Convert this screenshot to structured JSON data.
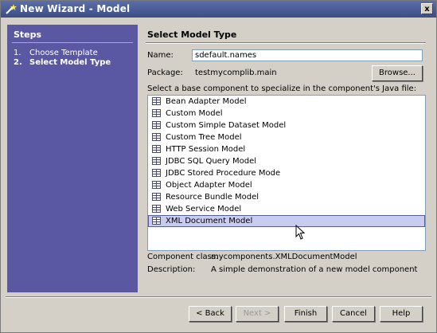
{
  "window": {
    "title": "New Wizard - Model",
    "close_label": "x"
  },
  "steps": {
    "header": "Steps",
    "items": [
      {
        "number": "1.",
        "label": "Choose Template"
      },
      {
        "number": "2.",
        "label": "Select Model Type"
      }
    ]
  },
  "page": {
    "title": "Select Model Type",
    "name_label": "Name:",
    "name_value": "sdefault.names",
    "package_label": "Package:",
    "package_value": "testmycomplib.main",
    "browse_label": "Browse...",
    "list_caption": "Select a base component to specialize in the component's Java file:",
    "models": [
      "Bean Adapter Model",
      "Custom Model",
      "Custom Simple Dataset Model",
      "Custom Tree Model",
      "HTTP Session Model",
      "JDBC SQL Query Model",
      "JDBC Stored Procedure Mode",
      "Object Adapter Model",
      "Resource Bundle Model",
      "Web Service Model",
      "XML Document Model"
    ],
    "selected_index": 10,
    "component_class_label": "Component class:",
    "component_class_value": "mycomponents.XMLDocumentModel",
    "description_label": "Description:",
    "description_value": "A simple demonstration of a new model component"
  },
  "buttons": {
    "back": "< Back",
    "next": "Next >",
    "finish": "Finish",
    "cancel": "Cancel",
    "help": "Help"
  },
  "colors": {
    "titlebar": "#3b4d86",
    "steps_panel": "#5b58a3",
    "selection": "#c8ccef"
  }
}
